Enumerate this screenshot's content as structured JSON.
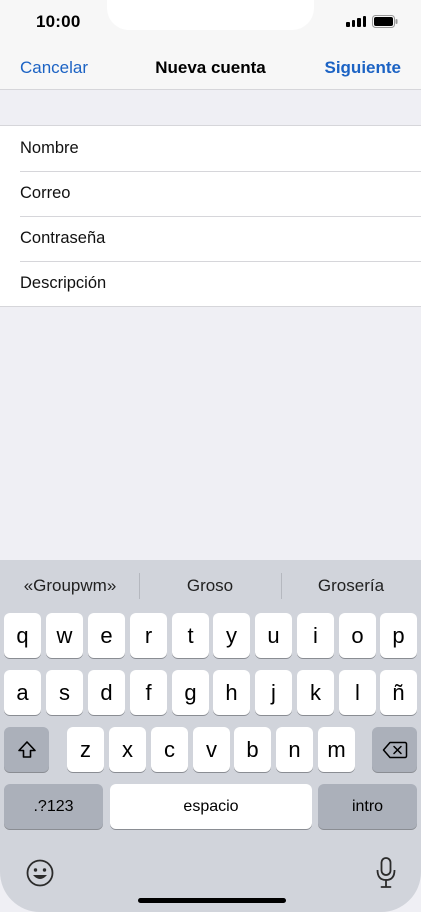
{
  "status": {
    "time": "10:00"
  },
  "nav": {
    "cancel": "Cancelar",
    "title": "Nueva cuenta",
    "next": "Siguiente"
  },
  "form": {
    "fields": [
      {
        "placeholder": "Nombre"
      },
      {
        "placeholder": "Correo"
      },
      {
        "placeholder": "Contraseña"
      },
      {
        "placeholder": "Descripción"
      }
    ]
  },
  "keyboard": {
    "suggestions": [
      "«Groupwm»",
      "Groso",
      "Grosería"
    ],
    "row1": [
      "q",
      "w",
      "e",
      "r",
      "t",
      "y",
      "u",
      "i",
      "o",
      "p"
    ],
    "row2": [
      "a",
      "s",
      "d",
      "f",
      "g",
      "h",
      "j",
      "k",
      "l",
      "ñ"
    ],
    "row3": [
      "z",
      "x",
      "c",
      "v",
      "b",
      "n",
      "m"
    ],
    "numbers_label": ".?123",
    "space_label": "espacio",
    "return_label": "intro",
    "shift_icon": "shift-icon",
    "delete_icon": "delete-icon",
    "emoji_icon": "emoji-icon",
    "mic_icon": "microphone-icon"
  },
  "colors": {
    "accent": "#1c63c4",
    "keyboard_bg": "#d1d4db",
    "dark_key": "#abb0ba"
  }
}
